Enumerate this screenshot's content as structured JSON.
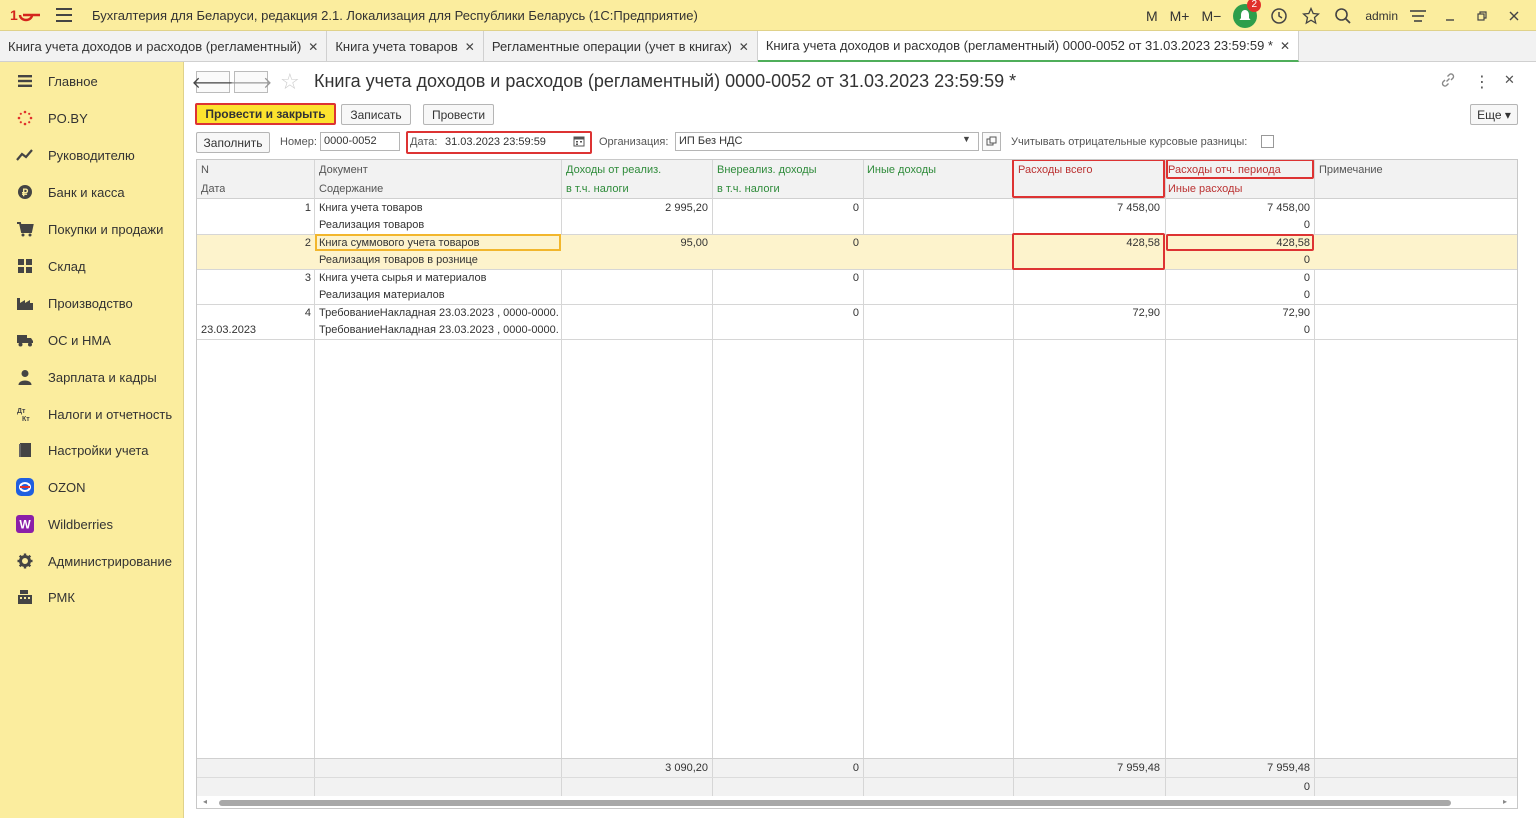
{
  "app": {
    "title": "Бухгалтерия для Беларуси, редакция 2.1. Локализация для Республики Беларусь  (1С:Предприятие)",
    "m_label": "M",
    "m_plus_label": "M+",
    "m_minus_label": "M−",
    "notification_count": "2",
    "user": "admin"
  },
  "tabs": [
    {
      "label": "Книга учета доходов и расходов (регламентный)"
    },
    {
      "label": "Книга учета товаров"
    },
    {
      "label": "Регламентные операции (учет в книгах)"
    },
    {
      "label": "Книга учета доходов и расходов (регламентный) 0000-0052 от 31.03.2023 23:59:59 *"
    }
  ],
  "sidebar": {
    "items": [
      {
        "label": "Главное",
        "icon": "menu-icon"
      },
      {
        "label": "PO.BY",
        "icon": "sparkle-icon"
      },
      {
        "label": "Руководителю",
        "icon": "chart-trend-icon"
      },
      {
        "label": "Банк и касса",
        "icon": "ruble-icon"
      },
      {
        "label": "Покупки и продажи",
        "icon": "cart-icon"
      },
      {
        "label": "Склад",
        "icon": "warehouse-icon"
      },
      {
        "label": "Производство",
        "icon": "factory-icon"
      },
      {
        "label": "ОС и НМА",
        "icon": "truck-icon"
      },
      {
        "label": "Зарплата и кадры",
        "icon": "person-icon"
      },
      {
        "label": "Налоги и отчетность",
        "icon": "dt-kt-icon"
      },
      {
        "label": "Настройки учета",
        "icon": "book-icon"
      },
      {
        "label": "OZON",
        "icon": "ozon-icon"
      },
      {
        "label": "Wildberries",
        "icon": "wildberries-icon"
      },
      {
        "label": "Администрирование",
        "icon": "gear-icon"
      },
      {
        "label": "РМК",
        "icon": "register-icon"
      }
    ]
  },
  "doc": {
    "title": "Книга учета доходов и расходов (регламентный) 0000-0052 от 31.03.2023 23:59:59 *",
    "more_label": "Еще ▾"
  },
  "toolbar": {
    "post_close": "Провести и закрыть",
    "save": "Записать",
    "post": "Провести"
  },
  "form": {
    "fill": "Заполнить",
    "number_label": "Номер:",
    "number_value": "0000-0052",
    "date_label": "Дата:",
    "date_value": "31.03.2023 23:59:59",
    "org_label": "Организация:",
    "org_value": "ИП Без НДС",
    "negative_label": "Учитывать отрицательные курсовые разницы:"
  },
  "table": {
    "headers": {
      "n": "N",
      "date": "Дата",
      "doc": "Документ",
      "content": "Содержание",
      "income_sales": "Доходы от реализ.",
      "income_sales_tax": "в т.ч. налоги",
      "nonop_income": "Внереализ. доходы",
      "nonop_income_tax": "в т.ч. налоги",
      "other_income": "Иные доходы",
      "expenses_total": "Расходы всего",
      "expenses_period": "Расходы отч. периода",
      "other_expenses": "Иные расходы",
      "note": "Примечание"
    },
    "rows": [
      {
        "n": "1",
        "date": "",
        "doc": "Книга учета товаров",
        "content": "Реализация товаров",
        "income_sales": "2 995,20",
        "nonop": "0",
        "expenses_total": "7 458,00",
        "expenses_period": "7 458,00",
        "other_expenses": "0"
      },
      {
        "n": "2",
        "date": "",
        "doc": "Книга суммового учета товаров",
        "content": "Реализация товаров в рознице",
        "income_sales": "95,00",
        "nonop": "0",
        "expenses_total": "428,58",
        "expenses_period": "428,58",
        "other_expenses": "0"
      },
      {
        "n": "3",
        "date": "",
        "doc": "Книга учета сырья и материалов",
        "content": "Реализация материалов",
        "income_sales": "",
        "nonop": "0",
        "expenses_total": "",
        "expenses_period": "0",
        "other_expenses": "0"
      },
      {
        "n": "4",
        "date": "23.03.2023",
        "doc": "ТребованиеНакладная 23.03.2023 , 0000-0000...",
        "content": "ТребованиеНакладная 23.03.2023 , 0000-0000...",
        "income_sales": "",
        "nonop": "0",
        "expenses_total": "72,90",
        "expenses_period": "72,90",
        "other_expenses": "0"
      }
    ],
    "totals": {
      "income_sales": "3 090,20",
      "nonop": "0",
      "expenses_total": "7 959,48",
      "expenses_period": "7 959,48",
      "other_expenses": "0"
    }
  },
  "colors": {
    "sidebar_bg": "#fbed9e",
    "primary_button": "#fde32e",
    "highlight_border": "#d33333",
    "header_green": "#2e8b3a",
    "header_red": "#b33333"
  }
}
